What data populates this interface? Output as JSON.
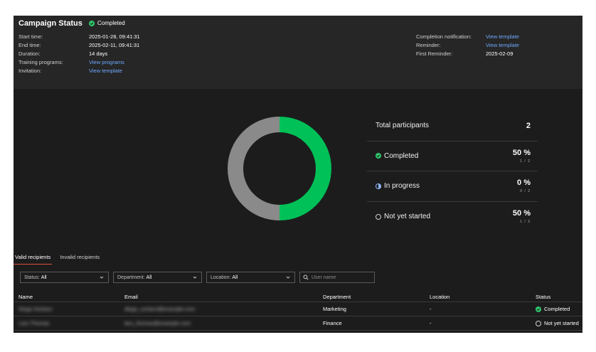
{
  "header": {
    "title": "Campaign Status",
    "status": "Completed",
    "left_rows": [
      {
        "label": "Start time:",
        "value": "2025-01-28, 09:41:31",
        "is_link": false
      },
      {
        "label": "End time:",
        "value": "2025-02-11, 09:41:31",
        "is_link": false
      },
      {
        "label": "Duration:",
        "value": "14 days",
        "is_link": false
      },
      {
        "label": "Training programs:",
        "value": "View programs",
        "is_link": true
      },
      {
        "label": "Invitation:",
        "value": "View template",
        "is_link": true
      }
    ],
    "right_rows": [
      {
        "label": "Completion notification:",
        "value": "View template",
        "is_link": true
      },
      {
        "label": "Reminder:",
        "value": "View template",
        "is_link": true
      },
      {
        "label": "First Reminder:",
        "value": "2025-02-09",
        "is_link": false
      }
    ]
  },
  "chart_data": {
    "type": "pie",
    "categories": [
      "Completed",
      "In progress",
      "Not yet started"
    ],
    "values": [
      1,
      0,
      1
    ],
    "colors": [
      "#00c158",
      "#8fb8ff",
      "#8a8a8a"
    ]
  },
  "stats": {
    "total_label": "Total participants",
    "total_value": "2",
    "rows": [
      {
        "label": "Completed",
        "percent": "50 %",
        "fraction": "1 / 2",
        "icon": "check-circle-icon"
      },
      {
        "label": "In progress",
        "percent": "0 %",
        "fraction": "0 / 2",
        "icon": "half-circle-icon"
      },
      {
        "label": "Not yet started",
        "percent": "50 %",
        "fraction": "1 / 2",
        "icon": "empty-circle-icon"
      }
    ]
  },
  "tabs": {
    "valid": "Valid recipients",
    "invalid": "Invalid recipients"
  },
  "filters": {
    "status_label": "Status:",
    "status_value": "All",
    "department_label": "Department:",
    "department_value": "All",
    "location_label": "Location:",
    "location_value": "All",
    "search_placeholder": "User name"
  },
  "table": {
    "columns": [
      "Name",
      "Email",
      "Department",
      "Location",
      "Status"
    ],
    "rows": [
      {
        "name": "Diego Soriano",
        "email": "diego_soriano@example.com",
        "department": "Marketing",
        "location": "-",
        "status": "Completed"
      },
      {
        "name": "Lars Thomas",
        "email": "lars_thomas@example.com",
        "department": "Finance",
        "location": "-",
        "status": "Not yet started"
      }
    ]
  },
  "colors": {
    "accent_link": "#6ea8ff",
    "completed_green": "#2ec56b",
    "tab_underline": "#e0533a"
  }
}
